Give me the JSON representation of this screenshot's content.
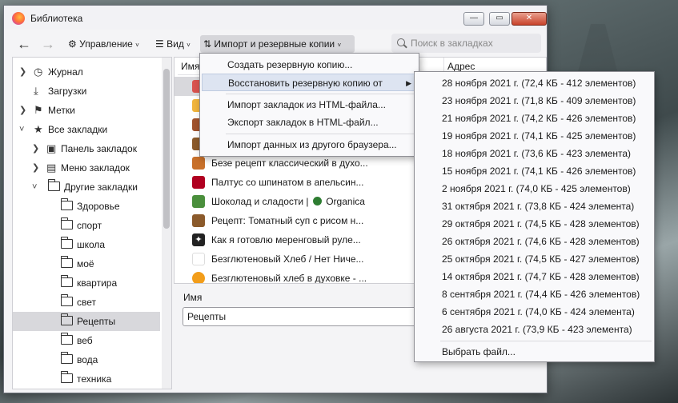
{
  "window": {
    "title": "Библиотека",
    "buttons": {
      "minimize": "—",
      "maximize": "▭",
      "close": "✕"
    }
  },
  "toolbar": {
    "back_icon": "arrow-left-icon",
    "forward_icon": "arrow-right-icon",
    "manage_label": "Управление",
    "view_label": "Вид",
    "import_label": "Импорт и резервные копии",
    "search_placeholder": "Поиск в закладках"
  },
  "sidebar": {
    "items": [
      {
        "label": "Журнал",
        "icon": "clock-icon"
      },
      {
        "label": "Загрузки",
        "icon": "download-icon"
      },
      {
        "label": "Метки",
        "icon": "tag-icon"
      },
      {
        "label": "Все закладки",
        "icon": "star-icon"
      },
      {
        "label": "Панель закладок",
        "icon": "bookmark-toolbar-icon"
      },
      {
        "label": "Меню закладок",
        "icon": "bookmark-menu-icon"
      },
      {
        "label": "Другие закладки",
        "icon": "folder-icon"
      },
      {
        "label": "Здоровье",
        "icon": "folder-icon"
      },
      {
        "label": "спорт",
        "icon": "folder-icon"
      },
      {
        "label": "школа",
        "icon": "folder-icon"
      },
      {
        "label": "моё",
        "icon": "folder-icon"
      },
      {
        "label": "квартира",
        "icon": "folder-icon"
      },
      {
        "label": "свет",
        "icon": "folder-icon"
      },
      {
        "label": "Рецепты",
        "icon": "folder-icon"
      },
      {
        "label": "веб",
        "icon": "folder-icon"
      },
      {
        "label": "вода",
        "icon": "folder-icon"
      },
      {
        "label": "техника",
        "icon": "folder-icon"
      }
    ]
  },
  "content": {
    "columns": {
      "name": "Имя",
      "address": "Адрес"
    },
    "bookmarks": [
      {
        "label": "Безе рецепт классический в духо..."
      },
      {
        "label": "Палтус со шпинатом в апельсин..."
      },
      {
        "label": "Шоколад и сладости |",
        "suffix": "Organica"
      },
      {
        "label": "Рецепт: Томатный суп с рисом н..."
      },
      {
        "label": "Как я готовлю меренговый руле..."
      },
      {
        "label": "Безглютеновый Хлеб / Нет Ниче..."
      },
      {
        "label": "Безглютеновый хлеб в духовке - ..."
      }
    ]
  },
  "detail": {
    "name_label": "Имя",
    "name_value": "Рецепты"
  },
  "import_menu": {
    "items": [
      "Создать резервную копию...",
      "Восстановить резервную копию от",
      "Импорт закладок из HTML-файла...",
      "Экспорт закладок в HTML-файл...",
      "Импорт данных из другого браузера..."
    ]
  },
  "restore_menu": {
    "items": [
      "28 ноября 2021 г. (72,4 КБ - 412 элементов)",
      "23 ноября 2021 г. (71,8 КБ - 409 элементов)",
      "21 ноября 2021 г. (74,2 КБ - 426 элементов)",
      "19 ноября 2021 г. (74,1 КБ - 425 элементов)",
      "18 ноября 2021 г. (73,6 КБ - 423 элемента)",
      "15 ноября 2021 г. (74,1 КБ - 426 элементов)",
      "2 ноября 2021 г. (74,0 КБ - 425 элементов)",
      "31 октября 2021 г. (73,8 КБ - 424 элемента)",
      "29 октября 2021 г. (74,5 КБ - 428 элементов)",
      "26 октября 2021 г. (74,6 КБ - 428 элементов)",
      "25 октября 2021 г. (74,5 КБ - 427 элементов)",
      "14 октября 2021 г. (74,7 КБ - 428 элементов)",
      "8 сентября 2021 г. (74,4 КБ - 426 элементов)",
      "6 сентября 2021 г. (74,0 КБ - 424 элемента)",
      "26 августа 2021 г. (73,9 КБ - 423 элемента)"
    ],
    "choose_file": "Выбрать файл..."
  }
}
